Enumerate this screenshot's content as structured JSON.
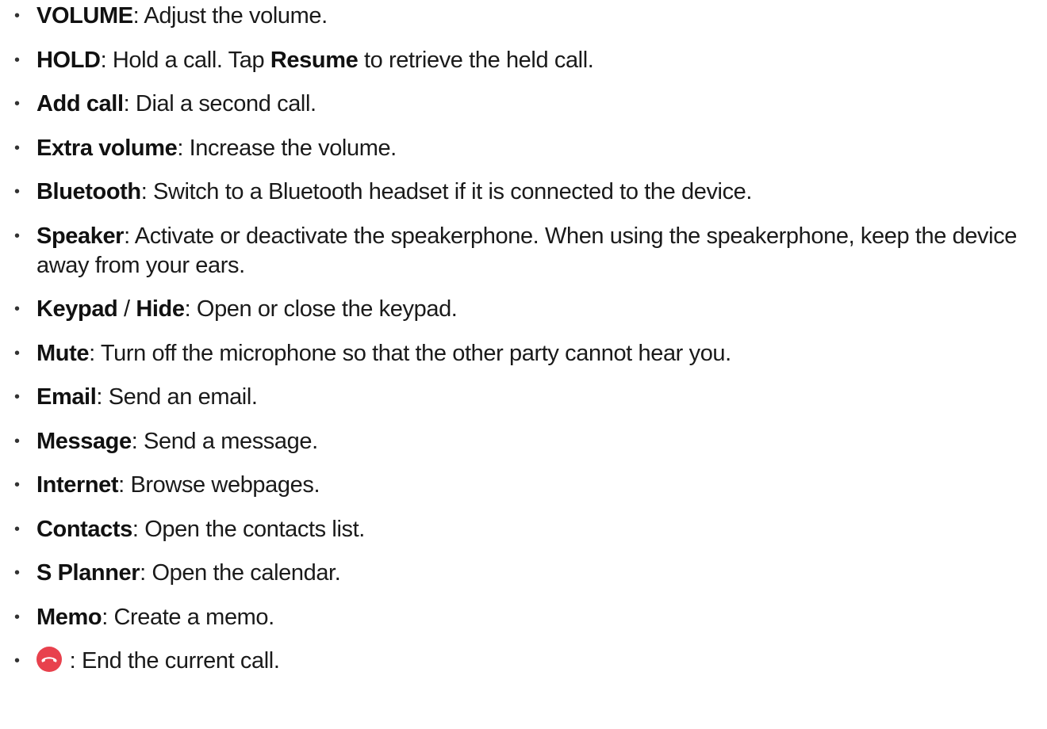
{
  "items": [
    {
      "term": "VOLUME",
      "desc": ": Adjust the volume."
    },
    {
      "term": "HOLD",
      "desc_pre": ": Hold a call. Tap ",
      "term2": "Resume",
      "desc_post": " to retrieve the held call."
    },
    {
      "term": "Add call",
      "desc": ": Dial a second call."
    },
    {
      "term": "Extra volume",
      "desc": ": Increase the volume."
    },
    {
      "term": "Bluetooth",
      "desc": ": Switch to a Bluetooth headset if it is connected to the device."
    },
    {
      "term": "Speaker",
      "desc": ": Activate or deactivate the speakerphone. When using the speakerphone, keep the device away from your ears."
    },
    {
      "term": "Keypad",
      "sep": " / ",
      "term2": "Hide",
      "desc": ": Open or close the keypad."
    },
    {
      "term": "Mute",
      "desc": ": Turn off the microphone so that the other party cannot hear you."
    },
    {
      "term": "Email",
      "desc": ": Send an email."
    },
    {
      "term": "Message",
      "desc": ": Send a message."
    },
    {
      "term": "Internet",
      "desc": ": Browse webpages."
    },
    {
      "term": "Contacts",
      "desc": ": Open the contacts list."
    },
    {
      "term": "S Planner",
      "desc": ": Open the calendar."
    },
    {
      "term": "Memo",
      "desc": ": Create a memo."
    },
    {
      "icon": "end-call-icon",
      "icon_color": "#e8414d",
      "desc": " : End the current call."
    }
  ],
  "bullet_glyph": "•"
}
